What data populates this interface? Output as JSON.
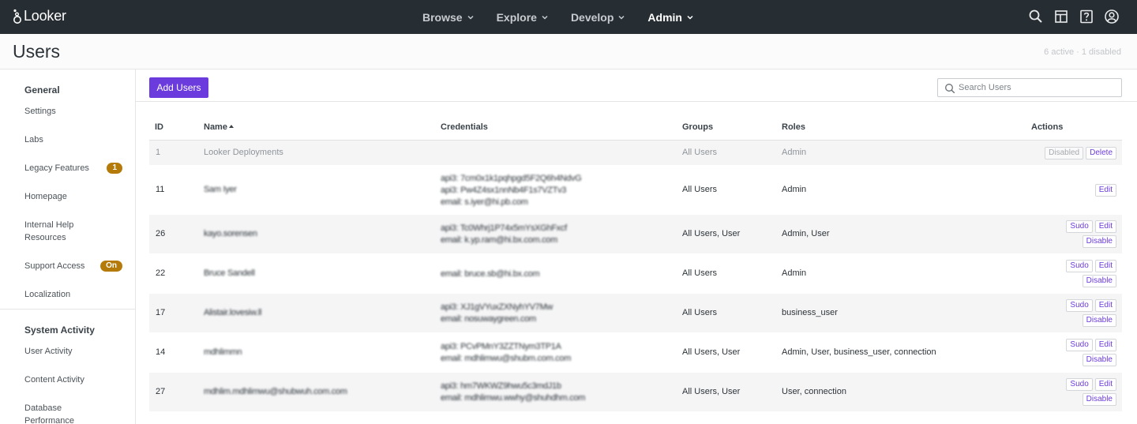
{
  "nav": {
    "brand": "Looker",
    "menu": [
      {
        "label": "Browse"
      },
      {
        "label": "Explore"
      },
      {
        "label": "Develop"
      },
      {
        "label": "Admin"
      }
    ]
  },
  "header": {
    "title": "Users",
    "status": "6 active · 1 disabled"
  },
  "sidebar": {
    "general_heading": "General",
    "general_items": [
      {
        "label": "Settings"
      },
      {
        "label": "Labs"
      },
      {
        "label": "Legacy Features",
        "badge": "1"
      },
      {
        "label": "Homepage"
      },
      {
        "label": "Internal Help Resources"
      },
      {
        "label": "Support Access",
        "badge": "On"
      },
      {
        "label": "Localization"
      }
    ],
    "system_heading": "System Activity",
    "system_items": [
      {
        "label": "User Activity"
      },
      {
        "label": "Content Activity"
      },
      {
        "label": "Database Performance"
      }
    ]
  },
  "toolbar": {
    "add_label": "Add Users",
    "search_placeholder": "Search Users"
  },
  "table": {
    "columns": {
      "id": "ID",
      "name": "Name",
      "credentials": "Credentials",
      "groups": "Groups",
      "roles": "Roles",
      "actions": "Actions"
    },
    "rows": [
      {
        "id": "1",
        "name": "Looker Deployments",
        "credentials": [],
        "groups": "All Users",
        "roles": "Admin",
        "actions": [
          [
            "Disabled",
            "Delete"
          ]
        ]
      },
      {
        "id": "11",
        "name": "Sam Iyer",
        "credentials": [
          "api3: 7cm0x1k1pqhpgd5F2Q6h4NdvG",
          "api3: Pw4Z4sx1nnNb4F1s7VZTv3",
          "email: s.iyer@hi.pb.com"
        ],
        "groups": "All Users",
        "roles": "Admin",
        "actions": [
          [
            "Edit"
          ]
        ]
      },
      {
        "id": "26",
        "name": "kayo.sorensen",
        "credentials": [
          "api3: Tc0Whrj1P74x5mYsXGhFxcf",
          "email: k.yp.ram@hi.bx.com.com"
        ],
        "groups": "All Users, User",
        "roles": "Admin, User",
        "actions": [
          [
            "Sudo",
            "Edit"
          ],
          [
            "Disable"
          ]
        ]
      },
      {
        "id": "22",
        "name": "Bruce Sandell",
        "credentials": [
          "email: bruce.sb@hi.bx.com"
        ],
        "groups": "All Users",
        "roles": "Admin",
        "actions": [
          [
            "Sudo",
            "Edit"
          ],
          [
            "Disable"
          ]
        ]
      },
      {
        "id": "17",
        "name": "Alistair.lovesiw.ll",
        "credentials": [
          "api3: XJ1gVYuxZXNyhYV7Mw",
          "email: nosuwaygreen.com"
        ],
        "groups": "All Users",
        "roles": "business_user",
        "actions": [
          [
            "Sudo",
            "Edit"
          ],
          [
            "Disable"
          ]
        ]
      },
      {
        "id": "14",
        "name": "mdhlimmn",
        "credentials": [
          "api3: PCvPMnY3ZZTNym3TP1A",
          "email: mdhlimwu@shubm.com.com"
        ],
        "groups": "All Users, User",
        "roles": "Admin, User, business_user, connection",
        "actions": [
          [
            "Sudo",
            "Edit"
          ],
          [
            "Disable"
          ]
        ]
      },
      {
        "id": "27",
        "name": "mdhlim.mdhlimwu@shubwuh.com.com",
        "credentials": [
          "api3: hm7WKWZ9hwu5c3mdJ1b",
          "email: mdhlimwu.wwhy@shuhdhm.com"
        ],
        "groups": "All Users, User",
        "roles": "User, connection",
        "actions": [
          [
            "Sudo",
            "Edit"
          ],
          [
            "Disable"
          ]
        ]
      }
    ]
  },
  "colors": {
    "nav_bg": "#262d33",
    "primary": "#6c3bde",
    "badge": "#b47b0b"
  },
  "icons": [
    "looker-logo-icon",
    "chevron-down-icon",
    "search-icon",
    "marketplace-icon",
    "help-icon",
    "account-icon",
    "sort-asc-icon"
  ]
}
